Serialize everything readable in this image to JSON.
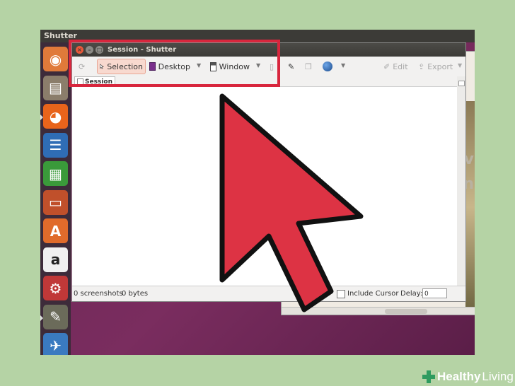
{
  "desktop": {
    "topbar_title": "Shutter",
    "bg_text": [
      "e v",
      "n"
    ]
  },
  "launcher": {
    "items": [
      {
        "name": "ubuntu-dash-icon",
        "glyph": "◉",
        "bg": "#e07a3a"
      },
      {
        "name": "files-icon",
        "glyph": "▤",
        "bg": "#8b7d6b"
      },
      {
        "name": "firefox-icon",
        "glyph": "◕",
        "bg": "#e8641b"
      },
      {
        "name": "writer-icon",
        "glyph": "☰",
        "bg": "#2f6db5"
      },
      {
        "name": "calc-icon",
        "glyph": "▦",
        "bg": "#3a9a3a"
      },
      {
        "name": "impress-icon",
        "glyph": "▭",
        "bg": "#c0502b"
      },
      {
        "name": "software-center-icon",
        "glyph": "A",
        "bg": "#e06b2b"
      },
      {
        "name": "amazon-icon",
        "glyph": "a",
        "bg": "#f0f0f0"
      },
      {
        "name": "system-settings-icon",
        "glyph": "⚙",
        "bg": "#c03838"
      },
      {
        "name": "gimp-icon",
        "glyph": "✎",
        "bg": "#6b6b5a"
      },
      {
        "name": "shutter-icon",
        "glyph": "✈",
        "bg": "#3a7ac0"
      }
    ]
  },
  "window": {
    "title": "Session - Shutter",
    "toolbar": {
      "selection_label": "Selection",
      "desktop_label": "Desktop",
      "window_label": "Window",
      "edit_label": "Edit",
      "export_label": "Export"
    },
    "tab_label": "Session",
    "status": {
      "screenshots": "0 screenshots",
      "size": "0 bytes",
      "include_cursor_label": "Include Cursor",
      "delay_label": "Delay:",
      "delay_value": "0"
    }
  },
  "colors": {
    "highlight": "#d8263d",
    "arrow_fill": "#dd3344",
    "background": "#b5d3a5"
  },
  "branding": {
    "brand_bold": "Healthy",
    "brand_light": "Living"
  }
}
